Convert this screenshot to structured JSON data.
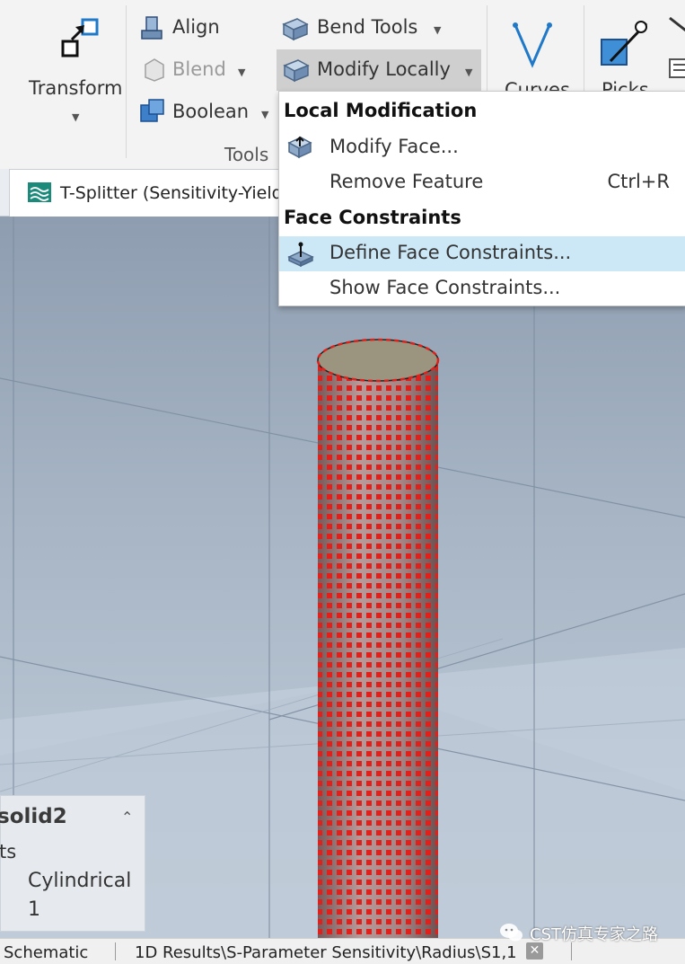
{
  "ribbon": {
    "transform_label": "Transform",
    "align_label": "Align",
    "blend_label": "Blend",
    "boolean_label": "Boolean",
    "bend_tools_label": "Bend Tools",
    "modify_locally_label": "Modify Locally",
    "curves_label": "Curves",
    "picks_label": "Picks",
    "group_tools_label": "Tools"
  },
  "document_tab": {
    "title": "T-Splitter (Sensitivity-Yield"
  },
  "menu": {
    "header_local": "Local Modification",
    "modify_face": "Modify Face...",
    "remove_feature": "Remove Feature",
    "remove_feature_shortcut": "Ctrl+R",
    "header_face": "Face Constraints",
    "define_face_constraints": "Define Face Constraints...",
    "show_face_constraints": "Show Face Constraints..."
  },
  "properties": {
    "title": "solid2",
    "row_prefix": "ts",
    "type_value": "Cylindrical",
    "count_value": "1"
  },
  "status_bar": {
    "tab_schematic": "Schematic",
    "tab_results": "1D Results\\S-Parameter Sensitivity\\Radius\\S1,1",
    "watermark": "CST仿真专家之路"
  },
  "colors": {
    "highlight": "#cce8f7",
    "face_marker": "#e0201a",
    "tab_icon": "#1a8a7a"
  }
}
